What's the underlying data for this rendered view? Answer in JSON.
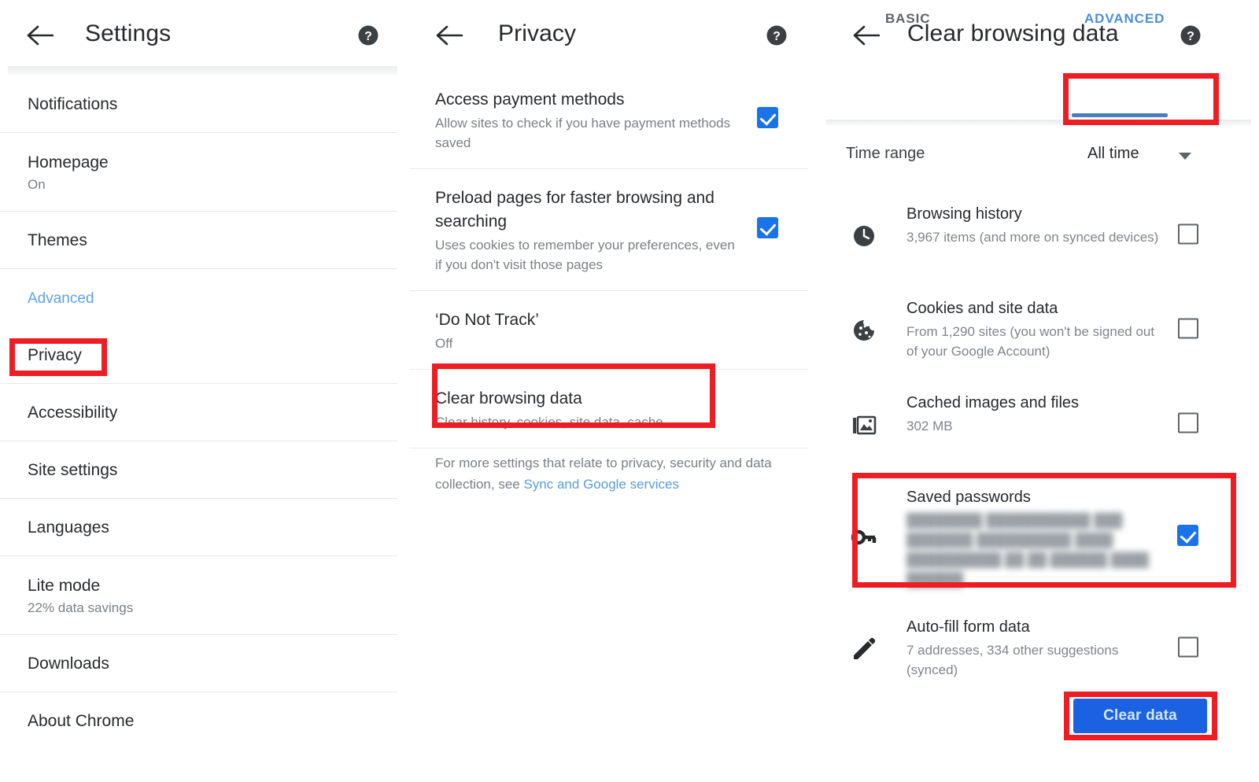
{
  "panels": {
    "settings": {
      "appbar": {
        "back_icon": "back-arrow-icon",
        "title": "Settings",
        "help_icon": "help-icon"
      },
      "items": [
        {
          "title": "Notifications",
          "sub": null,
          "type": "one"
        },
        {
          "title": "Homepage",
          "sub": "On",
          "type": "two"
        },
        {
          "title": "Themes",
          "sub": null,
          "type": "one"
        },
        {
          "title": "Advanced",
          "sub": null,
          "type": "link"
        },
        {
          "title": "Privacy",
          "sub": null,
          "type": "one"
        },
        {
          "title": "Accessibility",
          "sub": null,
          "type": "one"
        },
        {
          "title": "Site settings",
          "sub": null,
          "type": "one"
        },
        {
          "title": "Languages",
          "sub": null,
          "type": "one"
        },
        {
          "title": "Lite mode",
          "sub": "22% data savings",
          "type": "two"
        },
        {
          "title": "Downloads",
          "sub": null,
          "type": "one"
        },
        {
          "title": "About Chrome",
          "sub": null,
          "type": "one"
        }
      ]
    },
    "privacy": {
      "appbar": {
        "back_icon": "back-arrow-icon",
        "title": "Privacy",
        "help_icon": "help-icon"
      },
      "items": [
        {
          "title": "Access payment methods",
          "sub": "Allow sites to check if you have payment methods saved",
          "checked": true
        },
        {
          "title": "Preload pages for faster browsing and searching",
          "sub": "Uses cookies to remember your preferences, even if you don't visit those pages",
          "checked": true
        },
        {
          "title": "‘Do Not Track’",
          "sub": "Off",
          "checked": null
        },
        {
          "title": "Clear browsing data",
          "sub": "Clear history, cookies, site data, cache…",
          "checked": null
        }
      ],
      "footer": {
        "text": "For more settings that relate to privacy, security and data collection, see ",
        "link": "Sync and Google services"
      }
    },
    "clear_browsing_data": {
      "appbar": {
        "back_icon": "back-arrow-icon",
        "title": "Clear browsing data",
        "help_icon": "help-icon"
      },
      "tabs": [
        {
          "label": "BASIC",
          "selected": false
        },
        {
          "label": "ADVANCED",
          "selected": true
        }
      ],
      "time_range": {
        "label": "Time range",
        "value": "All time",
        "caret_icon": "chevron-down-icon"
      },
      "items": [
        {
          "icon": "clock-icon",
          "title": "Browsing history",
          "sub": "3,967 items (and more on synced devices)",
          "checked": false,
          "redacted": false
        },
        {
          "icon": "cookie-icon",
          "title": "Cookies and site data",
          "sub": "From 1,290 sites (you won't be signed out of your Google Account)",
          "checked": false,
          "redacted": false
        },
        {
          "icon": "photo-stack-icon",
          "title": "Cached images and files",
          "sub": "302 MB",
          "checked": false,
          "redacted": false
        },
        {
          "icon": "key-icon",
          "title": "Saved passwords",
          "sub": "████████ ███████████ ███\n███████ ██████████ ████\n██████████ ██ ██ ██████ ████\n██████",
          "checked": true,
          "redacted": true
        },
        {
          "icon": "pencil-icon",
          "title": "Auto-fill form data",
          "sub": "7 addresses, 334 other suggestions (synced)",
          "checked": false,
          "redacted": false
        }
      ],
      "clear_button": "Clear data"
    }
  },
  "annotations": {
    "highlight_color": "#EE1D23",
    "boxes": [
      "privacy-row-highlight",
      "clear-browsing-data-row-highlight",
      "advanced-tab-highlight",
      "saved-passwords-row-highlight",
      "clear-data-button-highlight"
    ]
  }
}
